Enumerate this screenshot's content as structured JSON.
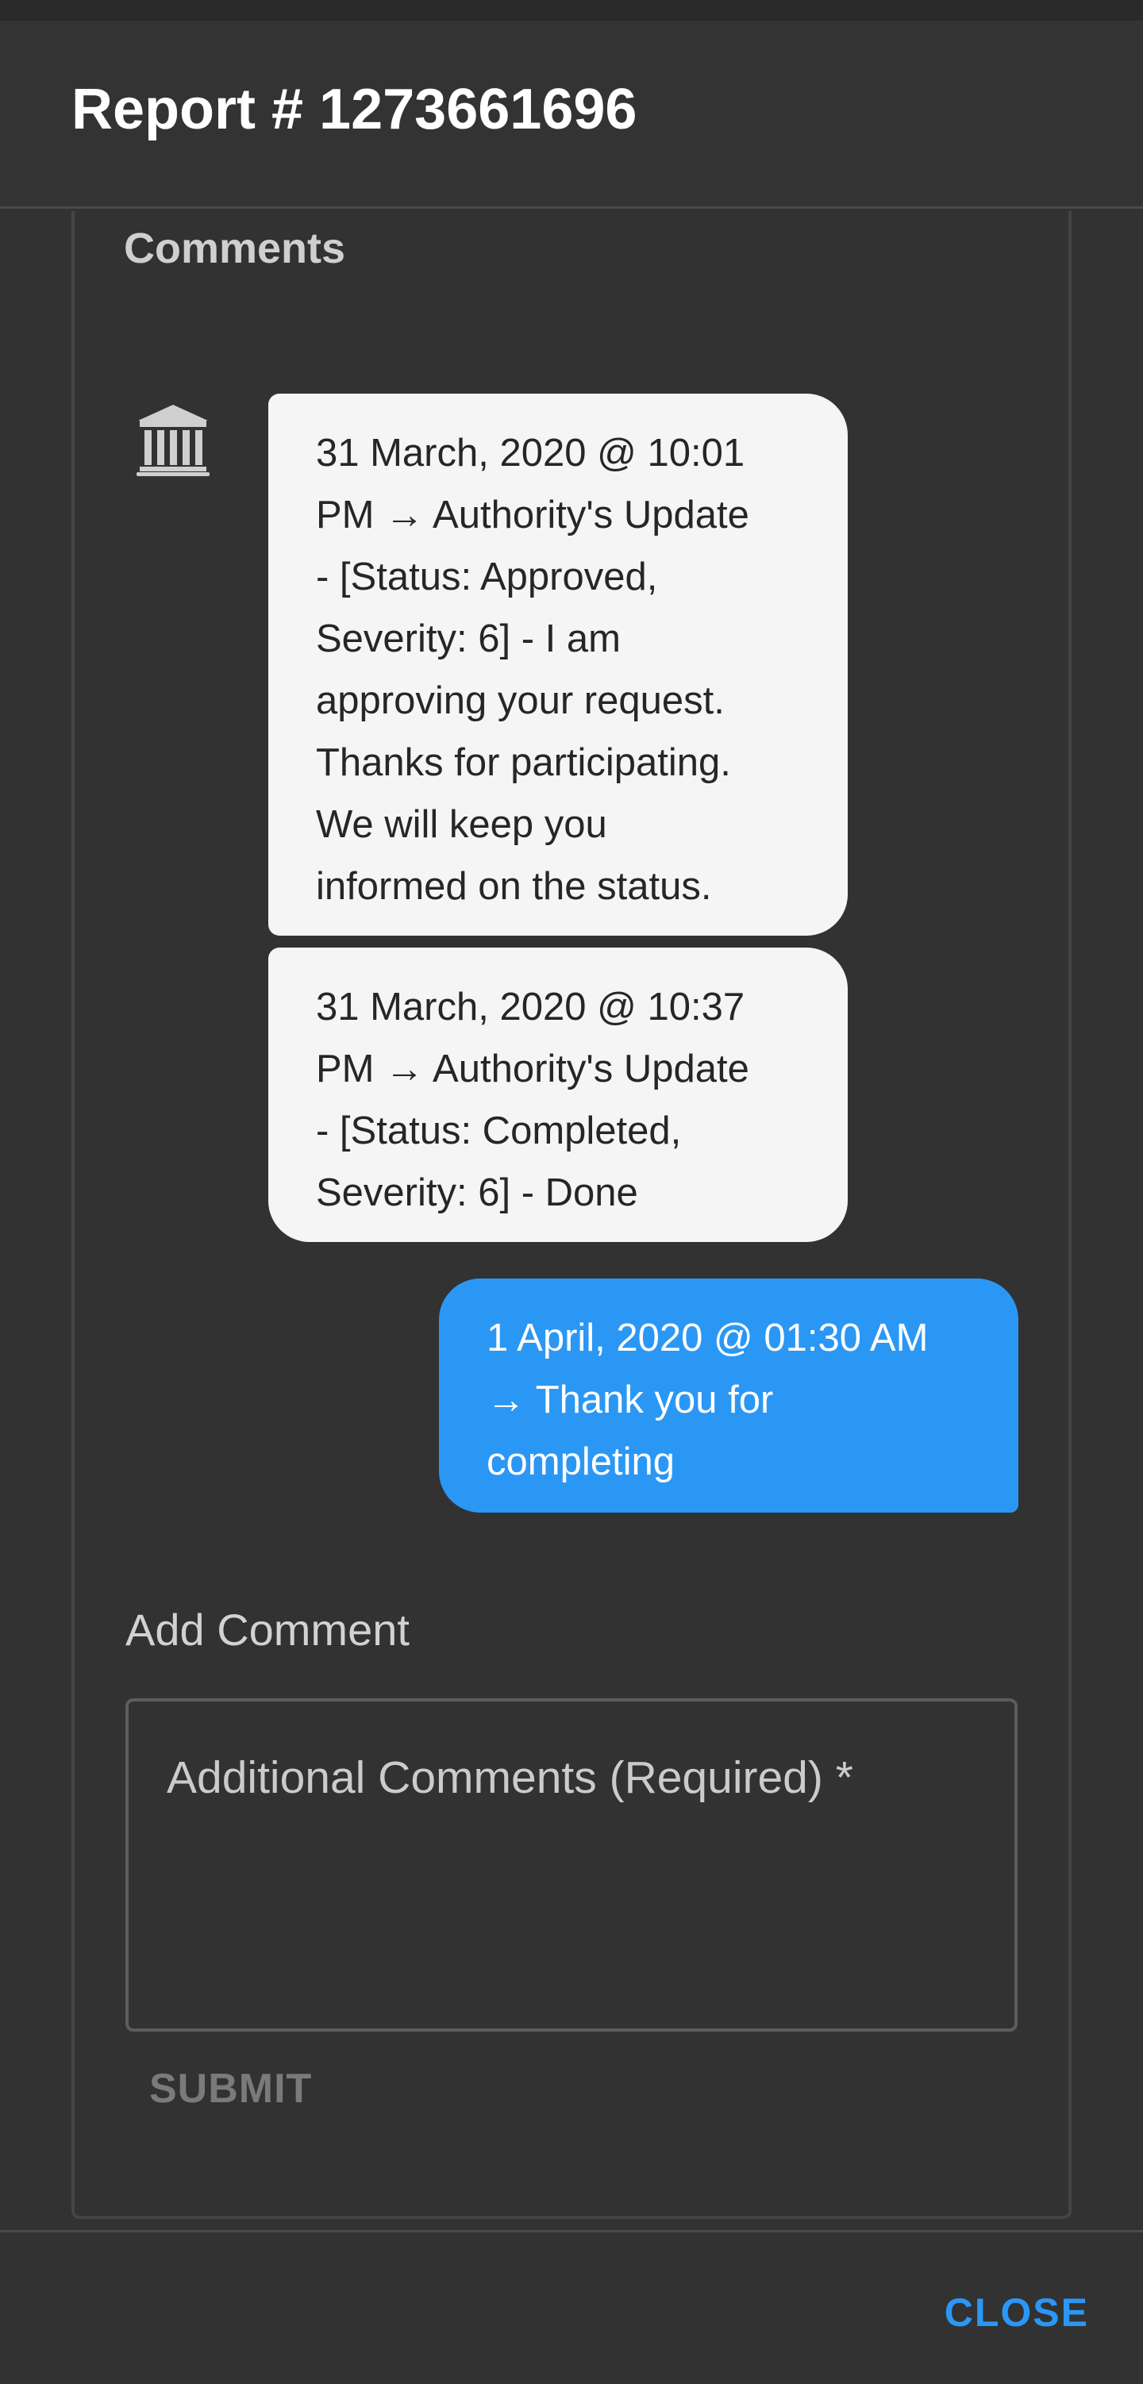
{
  "dialog": {
    "title": "Report # 1273661696"
  },
  "comments": {
    "section_title": "Comments",
    "avatar_icon": "bank-building-icon",
    "messages": [
      {
        "author": "authority",
        "lines": [
          "31 March, 2020 @ 10:01",
          "PM → Authority's Update",
          "- [Status: Approved,",
          "Severity: 6] - I am",
          "approving your request.",
          "Thanks for participating.",
          "We will keep you",
          "informed on the status."
        ]
      },
      {
        "author": "authority",
        "lines": [
          "31 March, 2020 @ 10:37",
          "PM → Authority's Update",
          "- [Status: Completed,",
          "Severity: 6] - Done"
        ]
      },
      {
        "author": "user",
        "lines": [
          "1 April, 2020 @ 01:30 AM",
          "→ Thank you for",
          "completing"
        ]
      }
    ]
  },
  "add_comment": {
    "label": "Add Comment",
    "placeholder": "Additional Comments (Required) *",
    "value": "",
    "submit_label": "SUBMIT"
  },
  "footer": {
    "close_label": "CLOSE"
  },
  "colors": {
    "accent": "#2b97f5",
    "background": "#323232",
    "authority_bubble": "#f5f5f5"
  }
}
